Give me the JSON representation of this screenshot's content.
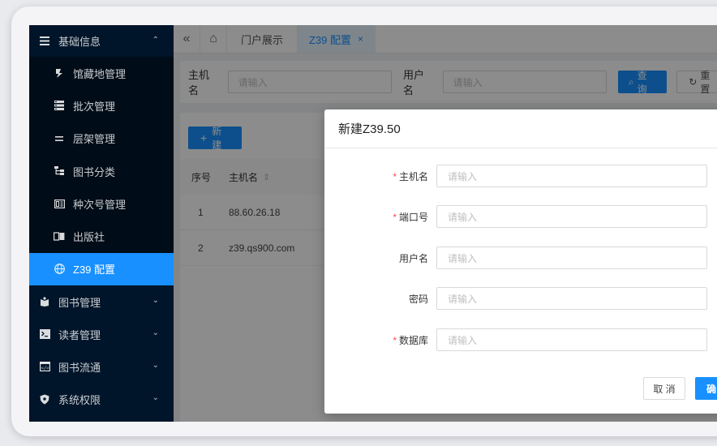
{
  "sidebar": {
    "group_basic": {
      "label": "基础信息",
      "icon": "list-icon",
      "arrow": "⌃"
    },
    "sub_items": [
      {
        "label": "馆藏地管理",
        "icon": "library-icon"
      },
      {
        "label": "批次管理",
        "icon": "batch-icon"
      },
      {
        "label": "层架管理",
        "icon": "shelf-icon"
      },
      {
        "label": "图书分类",
        "icon": "tree-icon"
      },
      {
        "label": "种次号管理",
        "icon": "number-icon"
      },
      {
        "label": "出版社",
        "icon": "book-open-icon"
      },
      {
        "label": "Z39 配置",
        "icon": "globe-icon"
      }
    ],
    "groups": [
      {
        "label": "图书管理",
        "icon": "book-icon",
        "arrow": "⌄"
      },
      {
        "label": "读者管理",
        "icon": "terminal-icon",
        "arrow": "⌄"
      },
      {
        "label": "图书流通",
        "icon": "code-icon",
        "arrow": "⌄"
      },
      {
        "label": "系统权限",
        "icon": "shield-icon",
        "arrow": "⌄"
      }
    ]
  },
  "tabs": {
    "collapse_icon": "«",
    "home_icon": "⌂",
    "items": [
      {
        "label": "门户展示"
      },
      {
        "label": "Z39 配置",
        "close": "×"
      }
    ]
  },
  "search": {
    "host_label": "主机名",
    "host_placeholder": "请输入",
    "user_label": "用户名",
    "user_placeholder": "请输入",
    "query_label": "查询",
    "query_icon": "⌕",
    "reset_label": "重置",
    "reset_icon": "↻"
  },
  "table": {
    "new_label": "新建",
    "new_icon": "+",
    "columns": [
      "序号",
      "主机名"
    ],
    "sort_icon": "⇕",
    "rows": [
      {
        "index": "1",
        "host": "88.60.26.18"
      },
      {
        "index": "2",
        "host": "z39.qs900.com"
      }
    ]
  },
  "modal": {
    "title": "新建Z39.50",
    "fields": [
      {
        "label": "主机名",
        "required": true,
        "placeholder": "请输入"
      },
      {
        "label": "端口号",
        "required": true,
        "placeholder": "请输入"
      },
      {
        "label": "用户名",
        "required": false,
        "placeholder": "请输入"
      },
      {
        "label": "密码",
        "required": false,
        "placeholder": "请输入"
      },
      {
        "label": "数据库",
        "required": true,
        "placeholder": "请输入"
      }
    ],
    "required_mark": "*",
    "cancel_label": "取 消",
    "ok_label": "确 定"
  },
  "colors": {
    "primary": "#1890ff",
    "sidebar_bg": "#001529",
    "sidebar_sub_bg": "#000c17",
    "required": "#ff4d4f"
  }
}
